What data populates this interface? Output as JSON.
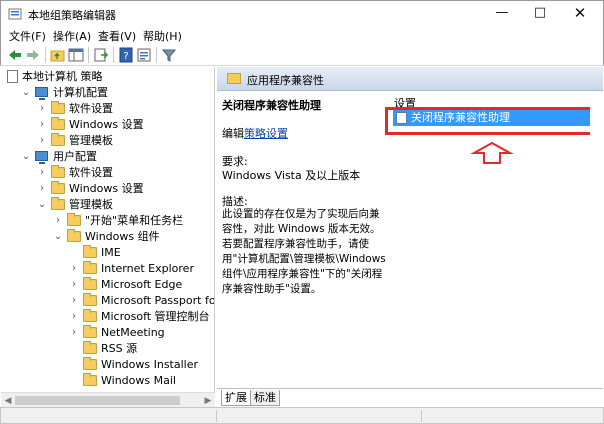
{
  "window": {
    "title": "本地组策略编辑器",
    "minimize": "—",
    "maximize": "□",
    "close": "✕"
  },
  "menu": [
    "文件(F)",
    "操作(A)",
    "查看(V)",
    "帮助(H)"
  ],
  "tree": [
    {
      "label": "本地计算机 策略",
      "indent": 0,
      "arrow": "",
      "icon": "doc-icon"
    },
    {
      "label": "计算机配置",
      "indent": 1,
      "arrow": "⌄",
      "icon": "computer-icon"
    },
    {
      "label": "软件设置",
      "indent": 2,
      "arrow": "›",
      "icon": "folder-icon"
    },
    {
      "label": "Windows 设置",
      "indent": 2,
      "arrow": "›",
      "icon": "folder-icon"
    },
    {
      "label": "管理模板",
      "indent": 2,
      "arrow": "›",
      "icon": "folder-icon"
    },
    {
      "label": "用户配置",
      "indent": 1,
      "arrow": "⌄",
      "icon": "computer-icon"
    },
    {
      "label": "软件设置",
      "indent": 2,
      "arrow": "›",
      "icon": "folder-icon"
    },
    {
      "label": "Windows 设置",
      "indent": 2,
      "arrow": "›",
      "icon": "folder-icon"
    },
    {
      "label": "管理模板",
      "indent": 2,
      "arrow": "⌄",
      "icon": "folder-icon"
    },
    {
      "label": "\"开始\"菜单和任务栏",
      "indent": 3,
      "arrow": "›",
      "icon": "folder-icon"
    },
    {
      "label": "Windows 组件",
      "indent": 3,
      "arrow": "⌄",
      "icon": "folder-icon"
    },
    {
      "label": "IME",
      "indent": 4,
      "arrow": "",
      "icon": "folder-icon"
    },
    {
      "label": "Internet Explorer",
      "indent": 4,
      "arrow": "›",
      "icon": "folder-icon"
    },
    {
      "label": "Microsoft Edge",
      "indent": 4,
      "arrow": "›",
      "icon": "folder-icon"
    },
    {
      "label": "Microsoft Passport for W",
      "indent": 4,
      "arrow": "›",
      "icon": "folder-icon"
    },
    {
      "label": "Microsoft 管理控制台",
      "indent": 4,
      "arrow": "›",
      "icon": "folder-icon"
    },
    {
      "label": "NetMeeting",
      "indent": 4,
      "arrow": "›",
      "icon": "folder-icon"
    },
    {
      "label": "RSS 源",
      "indent": 4,
      "arrow": "",
      "icon": "folder-icon"
    },
    {
      "label": "Windows Installer",
      "indent": 4,
      "arrow": "",
      "icon": "folder-icon"
    },
    {
      "label": "Windows Mail",
      "indent": 4,
      "arrow": "",
      "icon": "folder-icon"
    }
  ],
  "right": {
    "header": "应用程序兼容性",
    "desc_title": "关闭程序兼容性助理",
    "edit_prefix": "编辑",
    "edit_link": "策略设置",
    "req_heading": "要求:",
    "req_text": "Windows Vista 及以上版本",
    "desc_heading": "描述:",
    "desc_text": "此设置的存在仅是为了实现后向兼容性，对此 Windows 版本无效。若要配置程序兼容性助手，请使用\"计算机配置\\管理模板\\Windows 组件\\应用程序兼容性\"下的\"关闭程序兼容性助手\"设置。",
    "settings_heading": "设置",
    "setting_item": "关闭程序兼容性助理",
    "tabs": [
      "扩展",
      "标准"
    ]
  },
  "colors": {
    "selection": "#3399ff",
    "highlight_box": "#e4292c",
    "folder": "#f5cd5d"
  }
}
